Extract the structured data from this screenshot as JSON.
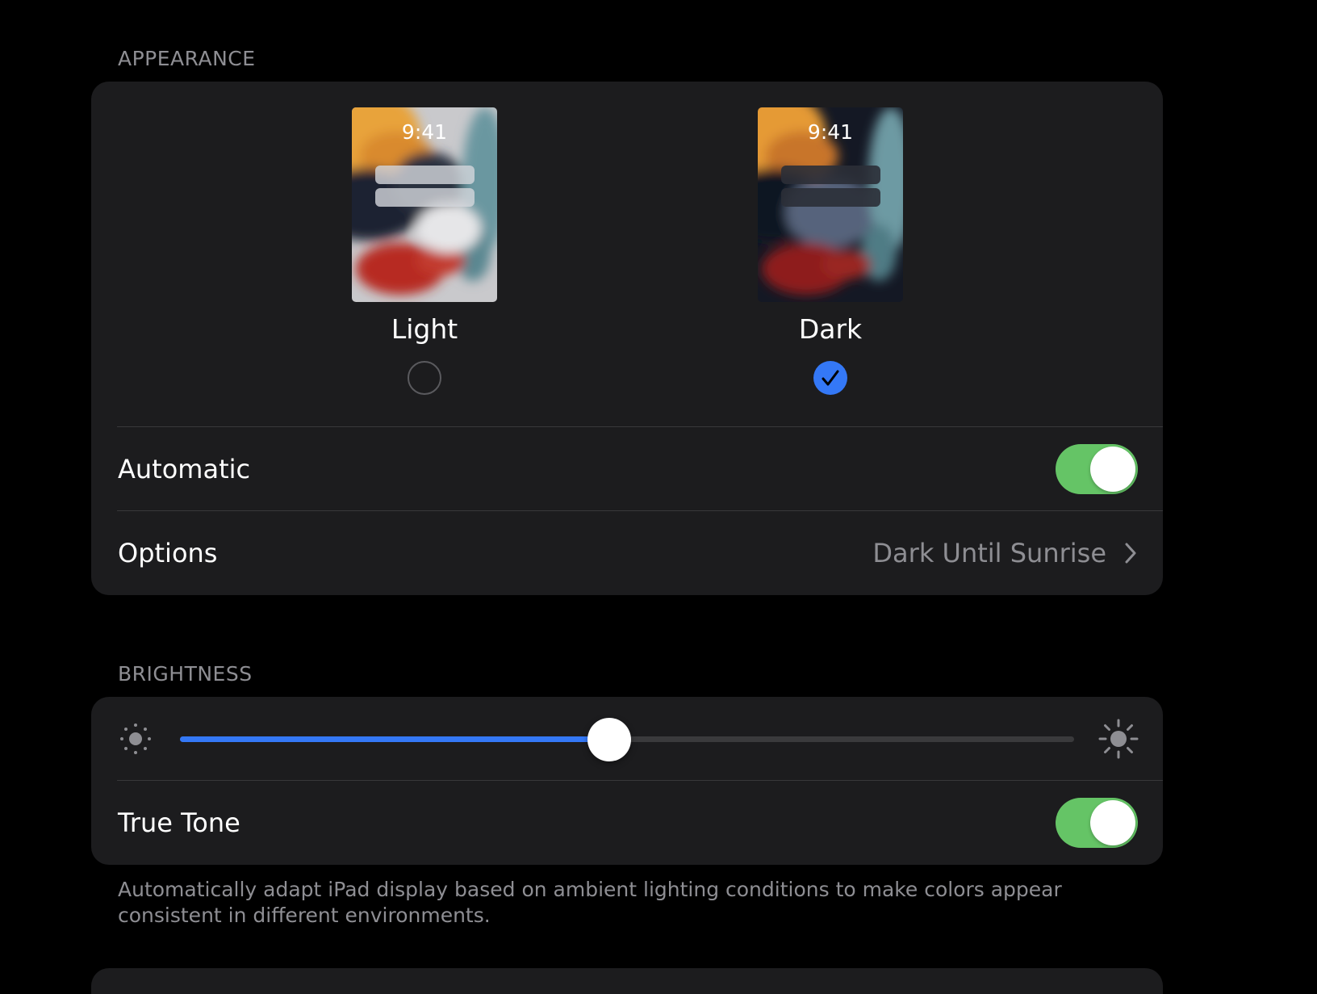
{
  "appearance": {
    "header": "APPEARANCE",
    "modes": [
      {
        "label": "Light",
        "time": "9:41",
        "selected": false
      },
      {
        "label": "Dark",
        "time": "9:41",
        "selected": true
      }
    ],
    "automatic": {
      "label": "Automatic",
      "on": true
    },
    "options": {
      "label": "Options",
      "value": "Dark Until Sunrise"
    }
  },
  "brightness": {
    "header": "BRIGHTNESS",
    "level": 0.48,
    "true_tone": {
      "label": "True Tone",
      "on": true
    },
    "footer": "Automatically adapt iPad display based on ambient lighting conditions to make colors appear consistent in different environments."
  },
  "icons": {
    "brightness_low": "sun-small-icon",
    "brightness_high": "sun-large-icon",
    "options_chevron": "chevron-right-icon",
    "selected_check": "checkmark-icon"
  },
  "colors": {
    "accent_blue": "#3478f6",
    "toggle_green": "#65c466",
    "group_background": "#1c1c1e",
    "secondary_text": "#8e8e93"
  }
}
